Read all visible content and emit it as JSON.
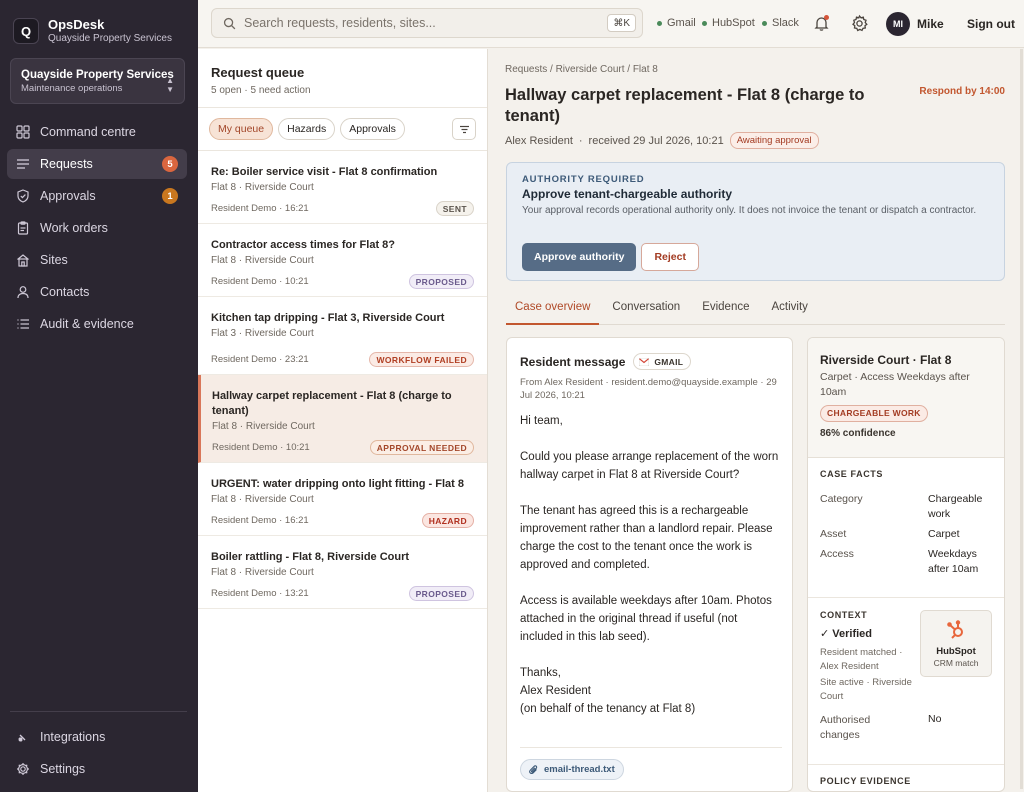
{
  "brand": {
    "logo_letter": "Q",
    "name": "OpsDesk",
    "sub": "Quayside Property Services"
  },
  "org": {
    "name": "Quayside Property Services",
    "sub": "Maintenance operations"
  },
  "nav": {
    "items": [
      {
        "label": "Command centre",
        "icon": "grid-icon"
      },
      {
        "label": "Requests",
        "icon": "list-icon",
        "badge": "5",
        "badge_color": "#d9663f"
      },
      {
        "label": "Approvals",
        "icon": "shield-check-icon",
        "badge": "1",
        "badge_color": "#c9771f"
      },
      {
        "label": "Work orders",
        "icon": "clipboard-icon"
      },
      {
        "label": "Sites",
        "icon": "building-icon"
      },
      {
        "label": "Contacts",
        "icon": "user-icon"
      },
      {
        "label": "Audit & evidence",
        "icon": "checklist-icon"
      }
    ],
    "bottom": [
      {
        "label": "Integrations",
        "icon": "plug-icon"
      },
      {
        "label": "Settings",
        "icon": "gear-icon"
      }
    ]
  },
  "topbar": {
    "search_placeholder": "Search requests, residents, sites...",
    "shortcut": "⌘K",
    "integrations": [
      "Gmail",
      "HubSpot",
      "Slack"
    ],
    "avatar_initials": "MI",
    "user_name": "Mike",
    "signout": "Sign out"
  },
  "queue": {
    "title": "Request queue",
    "sub": "5 open · 5 need action",
    "filters": [
      "My queue",
      "Hazards",
      "Approvals"
    ],
    "requests": [
      {
        "title": "Re: Boiler service visit - Flat 8 confirmation",
        "site": "Flat 8 · Riverside Court",
        "meta": "Resident Demo · 16:21",
        "status": "SENT"
      },
      {
        "title": "Contractor access times for Flat 8?",
        "site": "Flat 8 · Riverside Court",
        "meta": "Resident Demo · 10:21",
        "status": "PROPOSED"
      },
      {
        "title": "Kitchen tap dripping - Flat 3, Riverside Court",
        "site": "Flat 3 · Riverside Court",
        "meta": "Resident Demo · 23:21",
        "status": "WORKFLOW FAILED"
      },
      {
        "title": "Hallway carpet replacement - Flat 8 (charge to tenant)",
        "site": "Flat 8 · Riverside Court",
        "meta": "Resident Demo · 10:21",
        "status": "APPROVAL NEEDED"
      },
      {
        "title": "URGENT: water dripping onto light fitting - Flat 8",
        "site": "Flat 8 · Riverside Court",
        "meta": "Resident Demo · 16:21",
        "status": "HAZARD"
      },
      {
        "title": "Boiler rattling - Flat 8, Riverside Court",
        "site": "Flat 8 · Riverside Court",
        "meta": "Resident Demo · 13:21",
        "status": "PROPOSED"
      }
    ]
  },
  "detail": {
    "breadcrumb": "Requests / Riverside Court / Flat 8",
    "title": "Hallway carpet replacement - Flat 8 (charge to tenant)",
    "respond_by": "Respond by 14:00",
    "resident": "Alex Resident",
    "received": "received 29 Jul 2026, 10:21",
    "status_badge": "Awaiting approval",
    "authority": {
      "kicker": "AUTHORITY REQUIRED",
      "title": "Approve tenant-chargeable authority",
      "desc": "Your approval records operational authority only. It does not invoice the tenant or dispatch a contractor.",
      "approve": "Approve authority",
      "reject": "Reject"
    },
    "tabs": [
      "Case overview",
      "Conversation",
      "Evidence",
      "Activity"
    ],
    "message": {
      "title": "Resident message",
      "channel": "GMAIL",
      "from": "From Alex Resident · resident.demo@quayside.example · 29 Jul 2026, 10:21",
      "p1": "Hi team,",
      "p2": "Could you please arrange replacement of the worn hallway carpet in Flat 8 at Riverside Court?",
      "p3": "The tenant has agreed this is a rechargeable improvement rather than a landlord repair. Please charge the cost to the tenant once the work is approved and completed.",
      "p4": "Access is available weekdays after 10am. Photos attached in the original thread if useful (not included in this lab seed).",
      "sign1": "Thanks,",
      "sign2": "Alex Resident",
      "sign3": "(on behalf of the tenancy at Flat 8)",
      "attachment": "email-thread.txt"
    },
    "facts": {
      "title": "Riverside Court · Flat 8",
      "sub": "Carpet · Access Weekdays after 10am",
      "badge": "CHARGEABLE WORK",
      "confidence": "86% confidence",
      "case_facts_label": "CASE FACTS",
      "rows": [
        {
          "k": "Category",
          "v": "Chargeable work"
        },
        {
          "k": "Asset",
          "v": "Carpet"
        },
        {
          "k": "Access",
          "v": "Weekdays after 10am"
        }
      ],
      "context_label": "CONTEXT",
      "verified": "✓ Verified",
      "ctx1": "Resident matched · Alex Resident",
      "ctx2": "Site active · Riverside Court",
      "hubspot_name": "HubSpot",
      "hubspot_sub": "CRM match",
      "auth_changes_k": "Authorised changes",
      "auth_changes_v": "No",
      "policy_label": "POLICY EVIDENCE"
    }
  }
}
